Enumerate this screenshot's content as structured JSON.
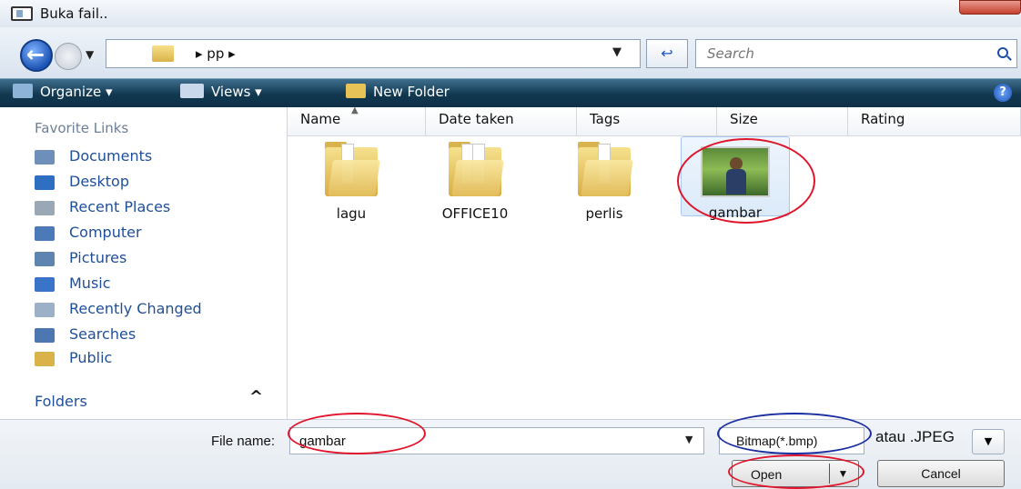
{
  "window": {
    "title": "Buka fail.."
  },
  "nav": {
    "back_label": "Back",
    "forward_label": "Forward",
    "address_path": "▸ pp ▸",
    "search_placeholder": "Search"
  },
  "toolbar": {
    "organize": "Organize ▾",
    "views": "Views  ▾",
    "new_folder": "New Folder",
    "help": "?"
  },
  "sidebar": {
    "heading": "Favorite Links",
    "items": [
      {
        "label": "Documents",
        "icon": "documents-icon",
        "color": "#6e8fb9"
      },
      {
        "label": "Desktop",
        "icon": "desktop-icon",
        "color": "#2f6fc2"
      },
      {
        "label": "Recent Places",
        "icon": "recent-places-icon",
        "color": "#9aa7b5"
      },
      {
        "label": "Computer",
        "icon": "computer-icon",
        "color": "#4c79b8"
      },
      {
        "label": "Pictures",
        "icon": "pictures-icon",
        "color": "#5e84b0"
      },
      {
        "label": "Music",
        "icon": "music-icon",
        "color": "#3a74c8"
      },
      {
        "label": "Recently Changed",
        "icon": "recently-changed-icon",
        "color": "#9cb0c8"
      },
      {
        "label": "Searches",
        "icon": "searches-icon",
        "color": "#4d77b0"
      },
      {
        "label": "Public",
        "icon": "public-folder-icon",
        "color": "#d9b34a"
      }
    ],
    "folders_label": "Folders",
    "folders_chevron": "^"
  },
  "columns": [
    "Name",
    "Date taken",
    "Tags",
    "Size",
    "Rating"
  ],
  "files": [
    {
      "name": "lagu",
      "type": "folder"
    },
    {
      "name": "OFFICE10",
      "type": "folder"
    },
    {
      "name": "perlis",
      "type": "folder"
    },
    {
      "name": "gambar",
      "type": "image",
      "selected": true
    }
  ],
  "bottom": {
    "file_name_label": "File name:",
    "file_name_value": "gambar",
    "file_type": "Bitmap(*.bmp)",
    "annotation": "atau .JPEG",
    "open_label": "Open",
    "cancel_label": "Cancel"
  },
  "colors": {
    "toolbar": "#11384f",
    "link": "#1f4f99",
    "annotation_red": "#e0152c",
    "annotation_blue": "#1b2ea0"
  }
}
